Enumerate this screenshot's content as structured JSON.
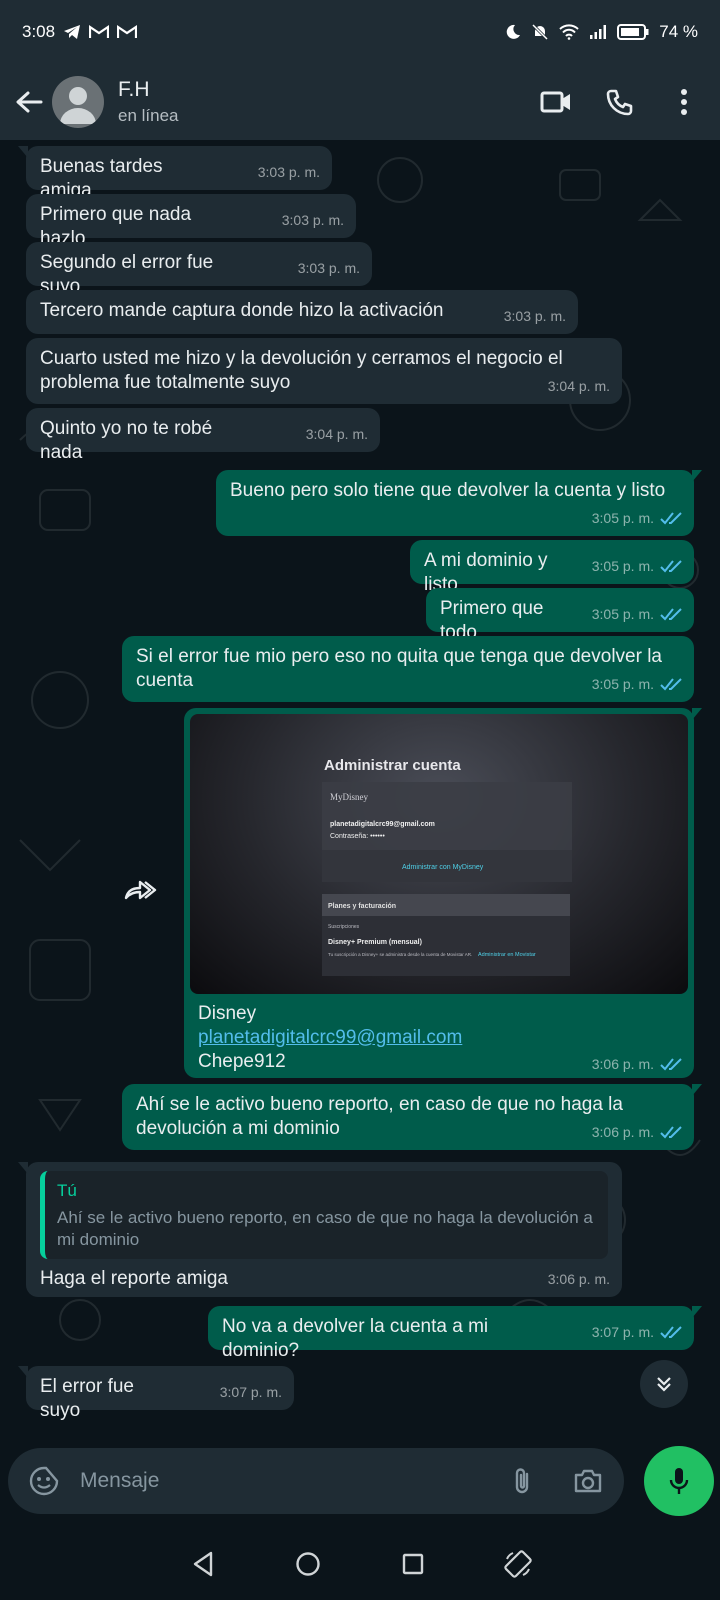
{
  "status_bar": {
    "time": "3:08",
    "notif_icons": [
      "telegram-icon",
      "gmail-icon",
      "gmail-icon"
    ],
    "battery": "74 %"
  },
  "header": {
    "name": "F.H",
    "status": "en línea"
  },
  "messages": [
    {
      "dir": "in",
      "text": "Buenas tardes amiga",
      "time": "3:03 p. m."
    },
    {
      "dir": "in",
      "text": "Primero que nada hazlo",
      "time": "3:03 p. m."
    },
    {
      "dir": "in",
      "text": "Segundo el error fue suyo",
      "time": "3:03 p. m."
    },
    {
      "dir": "in",
      "text": "Tercero mande captura donde hizo la activación",
      "time": "3:03 p. m."
    },
    {
      "dir": "in",
      "text": "Cuarto usted me hizo y la devolución y cerramos el negocio el problema fue totalmente suyo",
      "time": "3:04 p. m."
    },
    {
      "dir": "in",
      "text": "Quinto yo no te robé nada",
      "time": "3:04 p. m."
    },
    {
      "dir": "out",
      "text": "Bueno pero solo tiene que devolver la cuenta y listo",
      "time": "3:05 p. m."
    },
    {
      "dir": "out",
      "text": "A mi dominio y listo",
      "time": "3:05 p. m."
    },
    {
      "dir": "out",
      "text": "Primero que todo",
      "time": "3:05 p. m."
    },
    {
      "dir": "out",
      "text": "Si el error fue mio pero eso no quita que tenga que devolver la cuenta",
      "time": "3:05 p. m."
    },
    {
      "dir": "out",
      "text": "Ahí se le activo bueno reporto, en caso de que no haga la devolución a mi dominio",
      "time": "3:06 p. m."
    },
    {
      "dir": "in",
      "text": "Haga el reporte amiga",
      "time": "3:06 p. m."
    },
    {
      "dir": "out",
      "text": "No va a devolver la cuenta a mi dominio?",
      "time": "3:07 p. m."
    },
    {
      "dir": "in",
      "text": "El error fue suyo",
      "time": "3:07 p. m."
    }
  ],
  "media_message": {
    "image_title": "Administrar cuenta",
    "image_brand": "MyDisney",
    "image_email": "planetadigitalcrc99@gmail.com",
    "image_password_label": "Contraseña: ••••••",
    "image_manage_label": "Administrar con MyDisney",
    "image_section": "Planes y facturación",
    "image_subs": "Suscripciones",
    "image_plan": "Disney+ Premium (mensual)",
    "image_plan_note": "Tu suscripción a Disney+ se administra desde la cuenta de Movistar AR.",
    "image_plan_action": "Administrar en Movistar",
    "caption_line1": "Disney",
    "caption_link": "planetadigitalcrc99@gmail.com",
    "caption_line3": "Chepe912",
    "time": "3:06 p. m."
  },
  "quote": {
    "author": "Tú",
    "text": "Ahí se le activo bueno reporto, en caso de que no haga la devolución a mi dominio"
  },
  "composer": {
    "placeholder": "Mensaje"
  },
  "colors": {
    "outgoing_bubble": "#005c4b",
    "incoming_bubble": "#1f2c34",
    "accent_green": "#21c063",
    "read_ticks": "#53bdeb"
  }
}
